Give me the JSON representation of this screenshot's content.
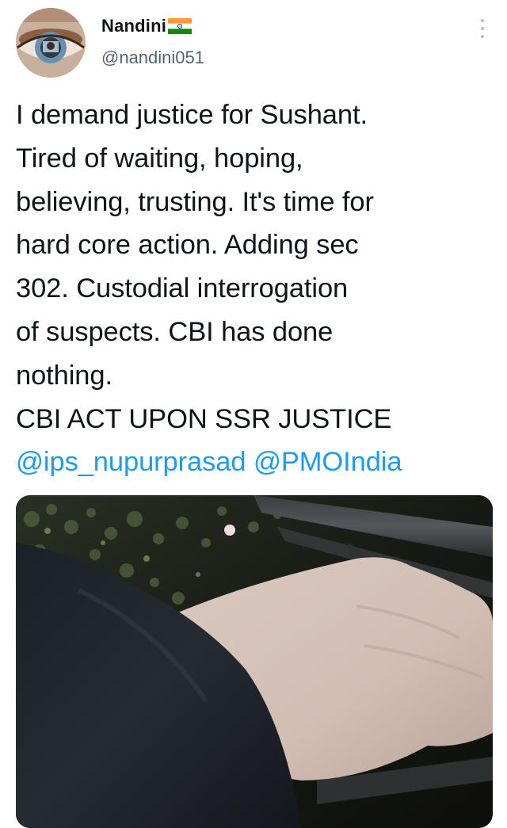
{
  "author": {
    "display_name": "Nandini",
    "handle": "@nandini051",
    "flag_icon": "india-flag-icon",
    "avatar_icon": "eye-avatar-icon"
  },
  "menu": {
    "icon": "more-vertical-icon"
  },
  "tweet": {
    "lines": [
      "I demand justice for Sushant.",
      "Tired of waiting, hoping,",
      "believing, trusting. It's time for",
      "hard core action. Adding sec",
      "302. Custodial interrogation",
      "of suspects. CBI has done",
      "nothing.",
      "CBI ACT UPON SSR JUSTICE"
    ],
    "mentions": [
      "@ips_nupurprasad",
      "@PMOIndia"
    ]
  },
  "colors": {
    "text": "#0f1419",
    "secondary": "#536471",
    "link": "#1d9bf0",
    "dots": "#b6bcc1"
  },
  "media": {
    "kind": "photo"
  }
}
